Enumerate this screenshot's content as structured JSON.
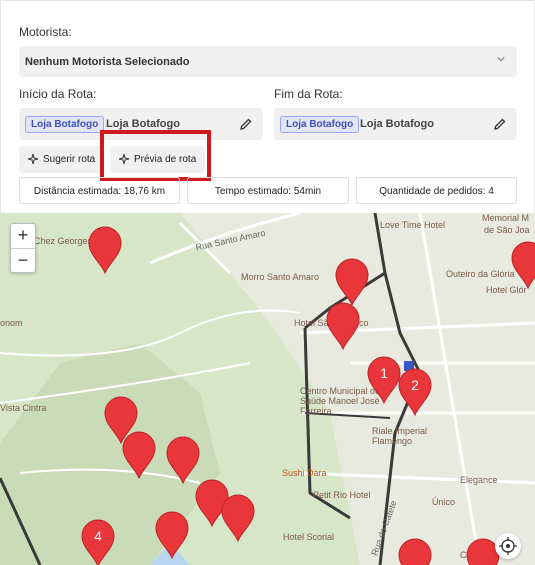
{
  "form": {
    "driver_label": "Motorista:",
    "driver_value": "Nenhum Motorista Selecionado",
    "start_label": "Início da Rota:",
    "start_chip": "Loja Botafogo",
    "start_value": "Loja Botafogo",
    "end_label": "Fim da Rota:",
    "end_chip": "Loja Botafogo",
    "end_value": "Loja Botafogo",
    "suggest_button": "Sugerir rota",
    "preview_button": "Prévia de rota"
  },
  "stats": {
    "distance": "Distância estimada: 18,76 km",
    "time": "Tempo estimado: 54min",
    "orders": "Quantidade de pedidos: 4"
  },
  "map": {
    "zoom_in": "+",
    "zoom_out": "−",
    "labels": {
      "chez_georges": "Chez Georges",
      "rua_santo_amaro": "Rua Santo Amaro",
      "love_time": "Love Time Hotel",
      "memorial": "Memorial M",
      "sao_joaquim": "de São Joa",
      "morro": "Morro Santo Amaro",
      "outeiro": "Outeiro da Glória",
      "hotel_gloria": "Hotel Glór",
      "hotel_sao_americo": "Hotel São Américo",
      "onom": "onom",
      "centro": "Centro Municipal de Saúde Manoel José Ferreira",
      "riale": "Riale Imperial Flamengo",
      "vista_cintra": "Vista Cintra",
      "sushi": "Sushi Dara",
      "petit_rio": "Petit Rio Hotel",
      "elegance": "Elegance",
      "unico": "Único",
      "scorial": "Hotel Scorial",
      "rua_catete": "Rua do Catete",
      "cat": "Ca"
    },
    "markers": [
      "1",
      "2",
      "4"
    ],
    "pin_color": "#e8363a"
  }
}
